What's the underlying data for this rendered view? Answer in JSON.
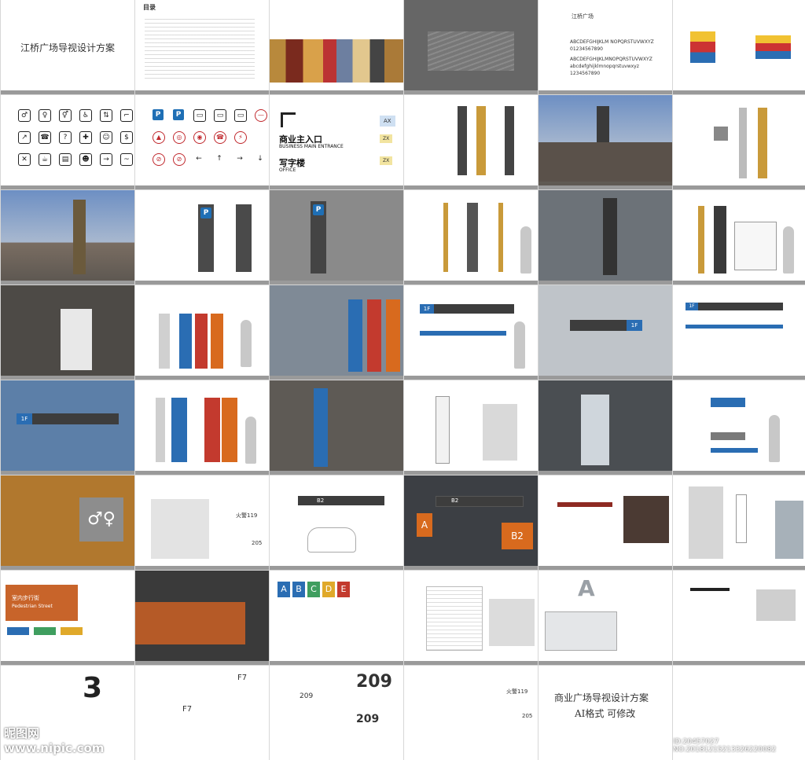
{
  "cover": {
    "title": "江桥广场导视设计方案"
  },
  "toc": {
    "title": "目录"
  },
  "brand": {
    "name_cn": "江桥广场",
    "alphabet_upper": "ABCDEFGHIJKLM NOPQRSTUVWXYZ",
    "digits": "01234567890",
    "alphabet_mixed": "ABCDEFGHIJKLMNOPQRSTUVWXYZ",
    "alphabet_lower": "abcdefghijklmnopqrstuvwxyz",
    "digits2": "1234567890"
  },
  "entrance_panel": {
    "code_top": "AX",
    "main_cn": "商业主入口",
    "main_en": "BUSINESS MAIN ENTRANCE",
    "code_main": "ZX",
    "office_cn": "写字楼",
    "office_en": "OFFICE",
    "code_office": "ZX"
  },
  "floor_signs": {
    "f1": "1F",
    "b2": "B2",
    "a": "A",
    "f7": "F7"
  },
  "parking": {
    "p": "P"
  },
  "fire": {
    "label": "火警119"
  },
  "pedestrian": {
    "cn": "室内步行街",
    "en": "Pedestrian Street"
  },
  "letters": [
    "A",
    "B",
    "C",
    "D",
    "E"
  ],
  "big_numbers": {
    "three": "3",
    "room": "209",
    "room2": "205"
  },
  "closing": {
    "title": "商业广场导视设计方案",
    "subtitle": "AI格式 可修改"
  },
  "watermark": {
    "site": "昵图网 www.nipic.com",
    "id": "ID:20457027 NO:20181215213326220082"
  },
  "colors": {
    "accent_blue": "#2a6db3",
    "accent_gold": "#c99a3a",
    "accent_orange": "#d86a1e",
    "accent_red": "#c33a2e",
    "dark": "#3a3a3a"
  }
}
